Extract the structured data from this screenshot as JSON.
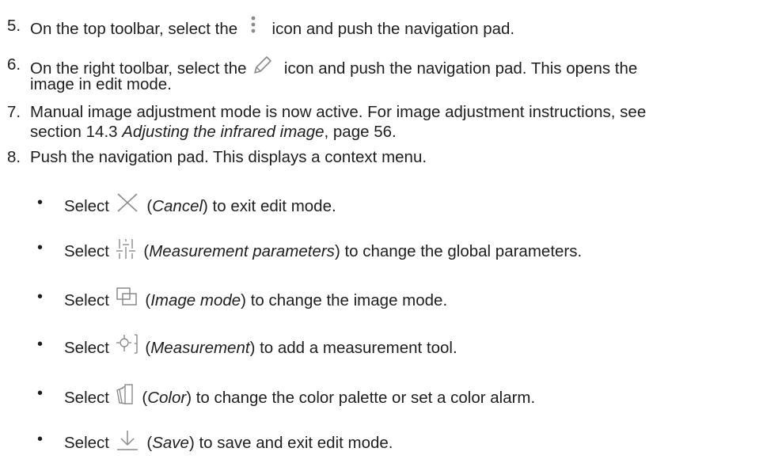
{
  "steps": [
    {
      "number": "5.",
      "before": "On the top toolbar, select the",
      "icon": "more-vertical-icon",
      "after": "icon and push the navigation pad."
    },
    {
      "number": "6.",
      "before": "On the right toolbar, select the",
      "icon": "pencil-icon",
      "after": "icon and push the navigation pad. This opens the",
      "line2": "image in edit mode."
    },
    {
      "number": "7.",
      "line1": "Manual image adjustment mode is now active. For image adjustment instructions, see",
      "line2_before": "section 14.3 ",
      "line2_italic": "Adjusting the infrared image",
      "line2_after": ", page 56."
    },
    {
      "number": "8.",
      "text": "Push the navigation pad. This displays a context menu."
    }
  ],
  "bullets": [
    {
      "bullet": "•",
      "select": "Select",
      "icon": "cancel-x-icon",
      "open": "(",
      "italic": "Cancel",
      "rest": ") to exit edit mode."
    },
    {
      "bullet": "•",
      "select": "Select",
      "icon": "sliders-icon",
      "open": "(",
      "italic": "Measurement parameters",
      "rest": ") to change the global parameters."
    },
    {
      "bullet": "•",
      "select": "Select",
      "icon": "image-mode-icon",
      "open": "(",
      "italic": "Image mode",
      "rest": ") to change the image mode."
    },
    {
      "bullet": "•",
      "select": "Select",
      "icon": "measurement-icon",
      "open": "(",
      "italic": "Measurement",
      "rest": ") to add a measurement tool."
    },
    {
      "bullet": "•",
      "select": "Select",
      "icon": "color-palette-icon",
      "open": "(",
      "italic": "Color",
      "rest": ") to change the color palette or set a color alarm."
    },
    {
      "bullet": "•",
      "select": "Select",
      "icon": "save-download-icon",
      "open": "(",
      "italic": "Save",
      "rest": ") to save and exit edit mode."
    }
  ]
}
